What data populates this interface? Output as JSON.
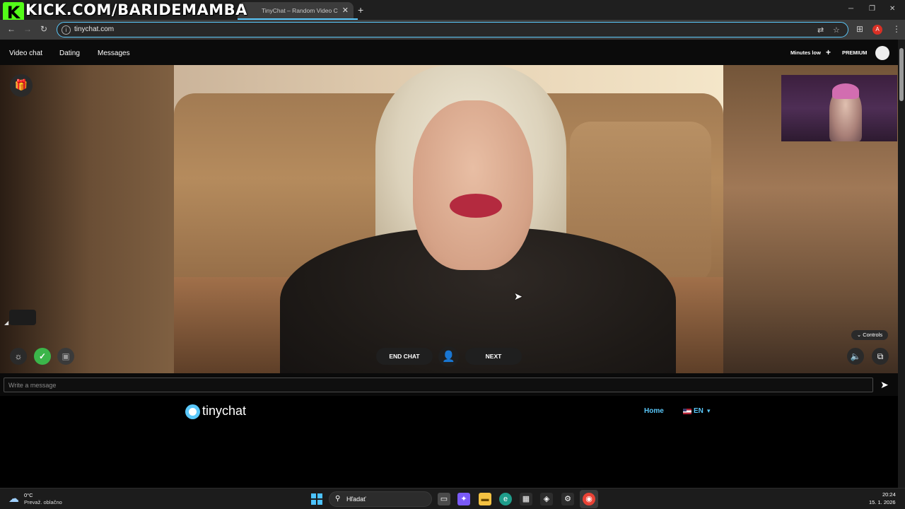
{
  "overlay": {
    "stream_text": "KICK.COM/BARIDEMAMBA",
    "logo_letter": "K"
  },
  "browser": {
    "tab_title": "TinyChat – Random Video C",
    "tab_close": "✕",
    "new_tab": "+",
    "url": "tinychat.com",
    "profile_initial": "A",
    "window_controls": [
      "─",
      "❐",
      "✕"
    ]
  },
  "header": {
    "nav": [
      "Video chat",
      "Dating",
      "Messages"
    ],
    "minutes_low": "Minutes low",
    "premium": "PREMIUM"
  },
  "video": {
    "end_chat": "END CHAT",
    "next": "NEXT",
    "controls": "⌄ Controls"
  },
  "message": {
    "placeholder": "Write a message"
  },
  "footer": {
    "logo_text": "tinychat",
    "home": "Home",
    "language": "EN"
  },
  "taskbar": {
    "temperature": "0°C",
    "weather": "Prevaž. oblačno",
    "search_placeholder": "Hľadať",
    "time": "20:24",
    "date": "15. 1. 2026"
  },
  "colors": {
    "accent": "#5ac8fa",
    "kick_green": "#53fc18",
    "check_green": "#3bb54a"
  },
  "icons": [
    "gift-icon",
    "lightbulb-icon",
    "check-icon",
    "save-icon",
    "person-icon",
    "volume-icon",
    "pip-icon",
    "send-icon",
    "search-icon",
    "windows-start-icon"
  ]
}
